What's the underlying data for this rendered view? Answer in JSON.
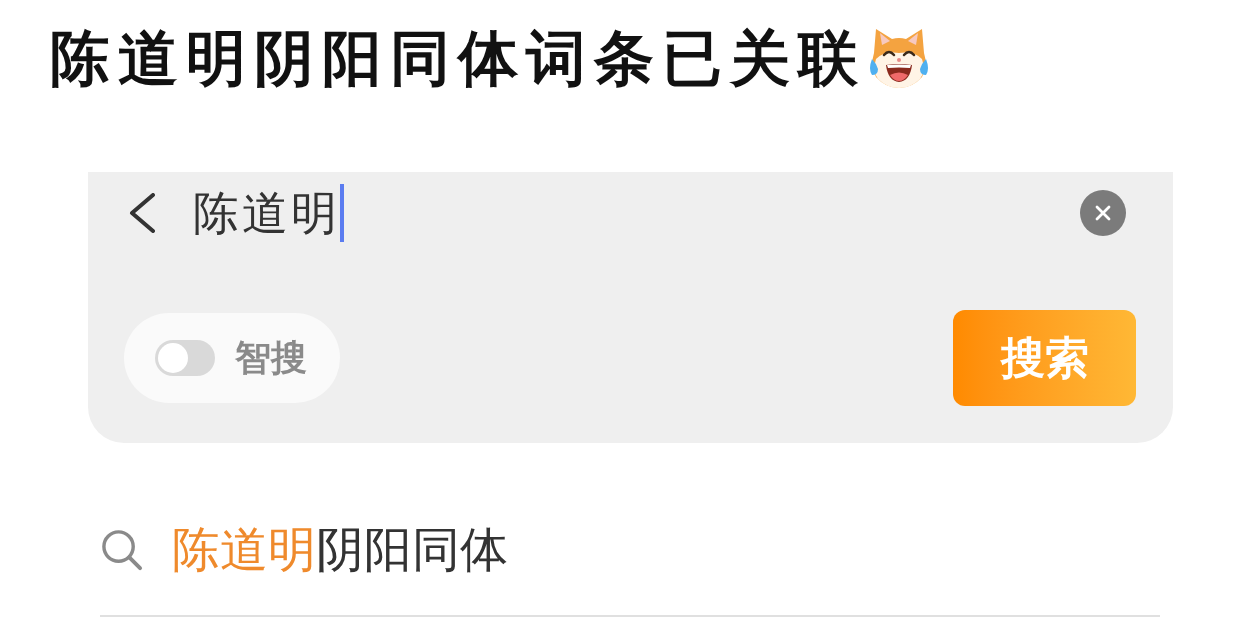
{
  "title": "陈道明阴阳同体词条已关联",
  "search_bar": {
    "value": "陈道明",
    "smart_search": {
      "label": "智搜",
      "on": false
    },
    "search_button": "搜索"
  },
  "suggestions": [
    {
      "segments": [
        {
          "text": "陈道明",
          "highlighted": true
        },
        {
          "text": "阴阳同体",
          "highlighted": false
        }
      ]
    }
  ]
}
